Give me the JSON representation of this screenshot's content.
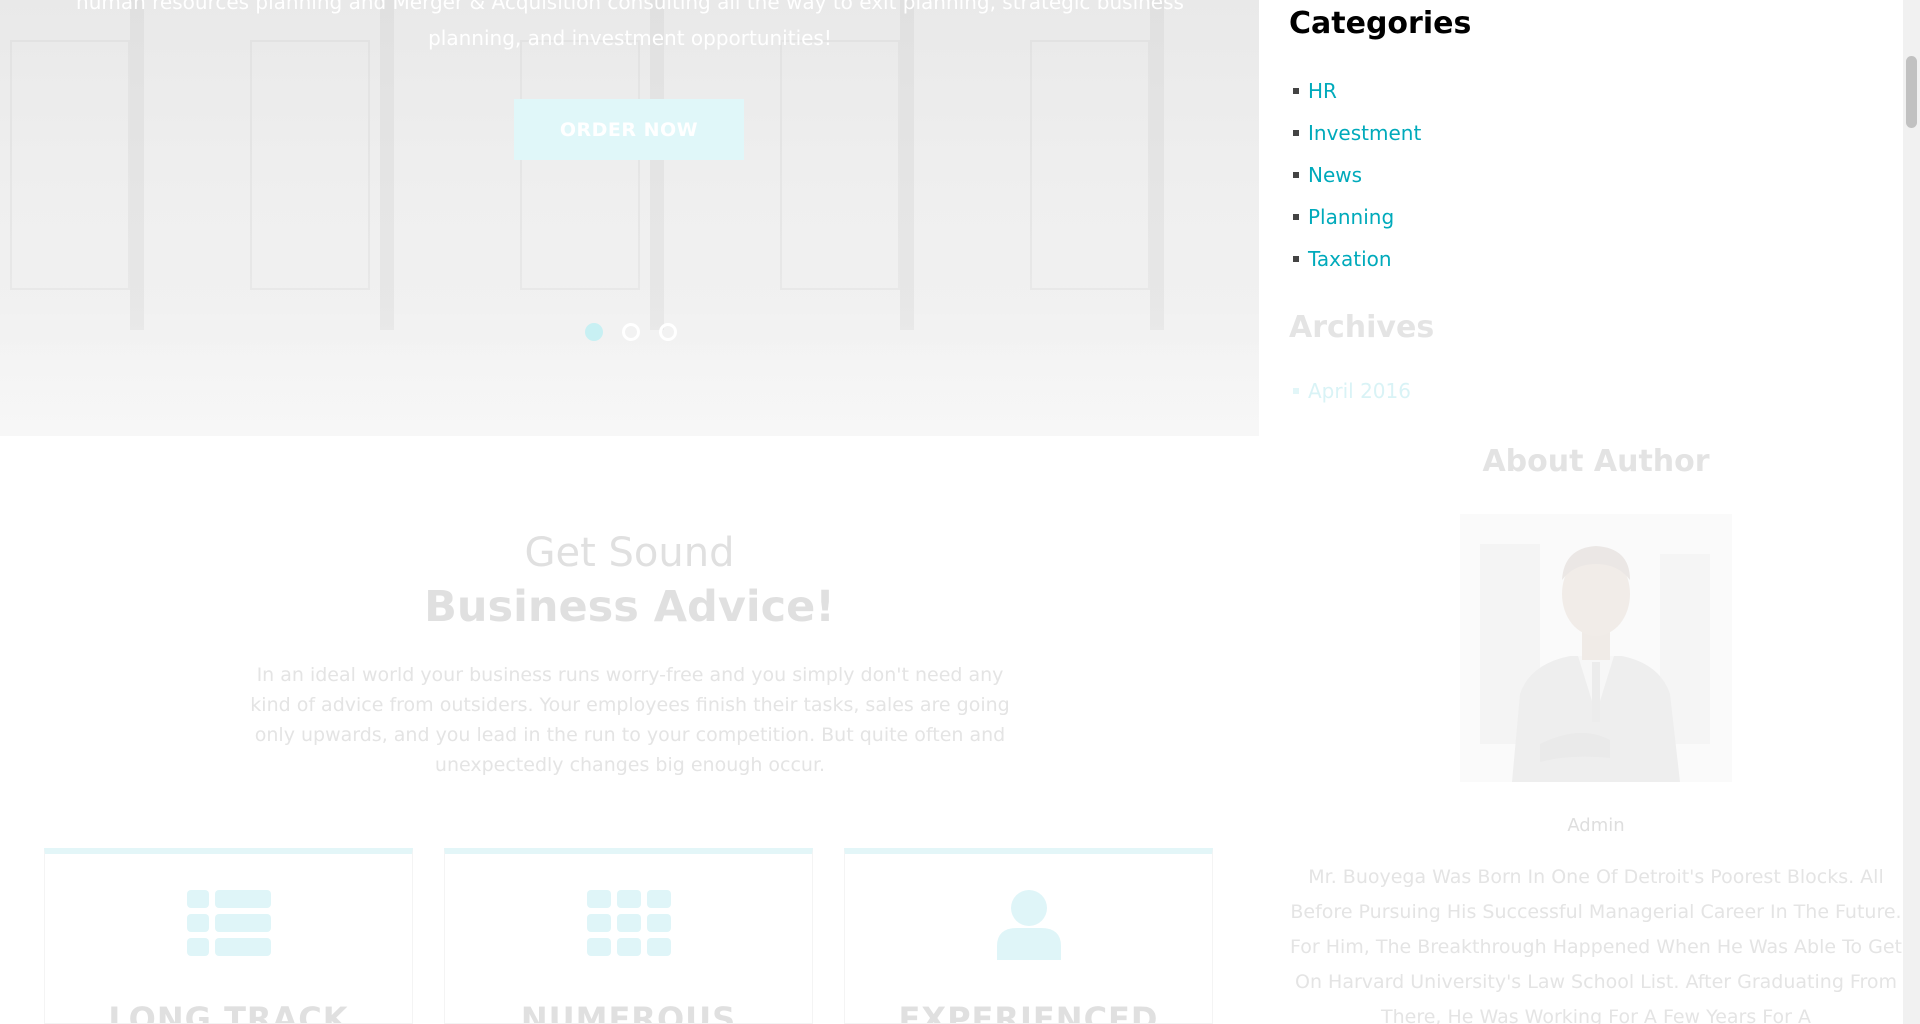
{
  "hero": {
    "text": "human resources planning and Merger & Acquisition consulting all the way to exit planning, strategic business planning, and investment opportunities!",
    "order_button": "ORDER NOW",
    "slides": 3,
    "active_slide": 1
  },
  "advice": {
    "line1": "Get Sound",
    "line2": "Business Advice!",
    "text": "In an ideal world your business runs worry-free and you simply don't need any kind of advice from outsiders. Your employees finish their tasks, sales are going only upwards, and you lead in the run to your competition. But quite often and unexpectedly changes big enough occur."
  },
  "features": [
    {
      "title": "LONG TRACK",
      "icon": "list-icon"
    },
    {
      "title": "NUMEROUS",
      "icon": "grid-icon"
    },
    {
      "title": "EXPERIENCED",
      "icon": "user-icon"
    }
  ],
  "sidebar": {
    "categories_title": "Categories",
    "categories": [
      "HR",
      "Investment",
      "News",
      "Planning",
      "Taxation"
    ],
    "archives_title": "Archives",
    "archives": [
      "April 2016"
    ],
    "author_title": "About Author",
    "author_name": "Admin",
    "author_bio": "Mr. Buoyega Was Born In One Of Detroit's Poorest Blocks. All Before Pursuing His Successful Managerial Career In The Future. For Him, The Breakthrough Happened When He Was Able To Get On Harvard University's Law School List. After Graduating From There, He Was Working For A Few Years For A"
  },
  "colors": {
    "accent": "#00aabb",
    "accent_faded": "#e0f7f9"
  }
}
